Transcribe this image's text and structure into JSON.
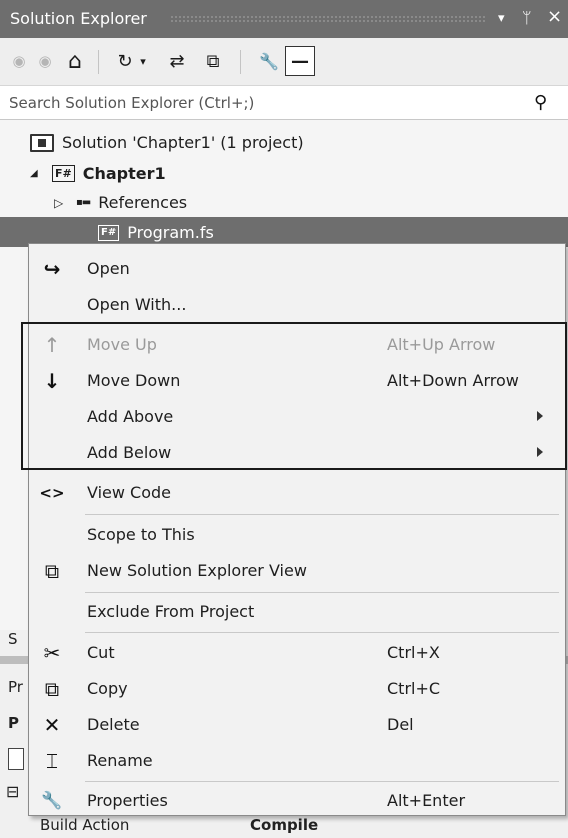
{
  "window": {
    "title": "Solution Explorer",
    "dropdown_glyph": "▾",
    "pin_glyph": "ᛘ",
    "close_glyph": "×"
  },
  "toolbar": {
    "back_glyph": "◉",
    "forward_glyph": "◉",
    "home_glyph": "⌂",
    "history_glyph": "↻",
    "history_dropdown_glyph": "▾",
    "sync_glyph": "⇄",
    "collapse_glyph": "⧉",
    "properties_glyph": "🔧",
    "preview_glyph": "—"
  },
  "search": {
    "placeholder": "Search Solution Explorer (Ctrl+;)",
    "icon_glyph": "⚲"
  },
  "tree": {
    "solution_label": "Solution 'Chapter1' (1 project)",
    "project_label": "Chapter1",
    "project_expander": "◢",
    "project_badge": "F#",
    "references_label": "References",
    "references_expander": "▷",
    "references_glyph": "▪▬",
    "file_label": "Program.fs",
    "file_badge": "F#"
  },
  "bottom_panel": {
    "tab_fragment": "S",
    "properties_fragment": "Pr",
    "row_fragment": "P",
    "expander_glyph": "⊟",
    "build_action_label": "Build Action",
    "build_action_value": "Compile"
  },
  "context_menu": {
    "items": [
      {
        "label": "Open",
        "shortcut": "",
        "icon": "↪",
        "enabled": true
      },
      {
        "label": "Open With...",
        "shortcut": "",
        "icon": "",
        "enabled": true
      },
      {
        "label": "Move Up",
        "shortcut": "Alt+Up Arrow",
        "icon": "↑",
        "enabled": false
      },
      {
        "label": "Move Down",
        "shortcut": "Alt+Down Arrow",
        "icon": "↓",
        "enabled": true
      },
      {
        "label": "Add Above",
        "shortcut": "",
        "icon": "",
        "enabled": true,
        "submenu": true
      },
      {
        "label": "Add Below",
        "shortcut": "",
        "icon": "",
        "enabled": true,
        "submenu": true
      },
      {
        "label": "View Code",
        "shortcut": "",
        "icon": "<>",
        "enabled": true
      },
      {
        "label": "Scope to This",
        "shortcut": "",
        "icon": "",
        "enabled": true
      },
      {
        "label": "New Solution Explorer View",
        "shortcut": "",
        "icon": "⧉",
        "enabled": true
      },
      {
        "label": "Exclude From Project",
        "shortcut": "",
        "icon": "",
        "enabled": true
      },
      {
        "label": "Cut",
        "shortcut": "Ctrl+X",
        "icon": "✂",
        "enabled": true
      },
      {
        "label": "Copy",
        "shortcut": "Ctrl+C",
        "icon": "⧉",
        "enabled": true
      },
      {
        "label": "Delete",
        "shortcut": "Del",
        "icon": "✕",
        "enabled": true
      },
      {
        "label": "Rename",
        "shortcut": "",
        "icon": "⌶",
        "enabled": true
      },
      {
        "label": "Properties",
        "shortcut": "Alt+Enter",
        "icon": "🔧",
        "enabled": true
      }
    ]
  }
}
